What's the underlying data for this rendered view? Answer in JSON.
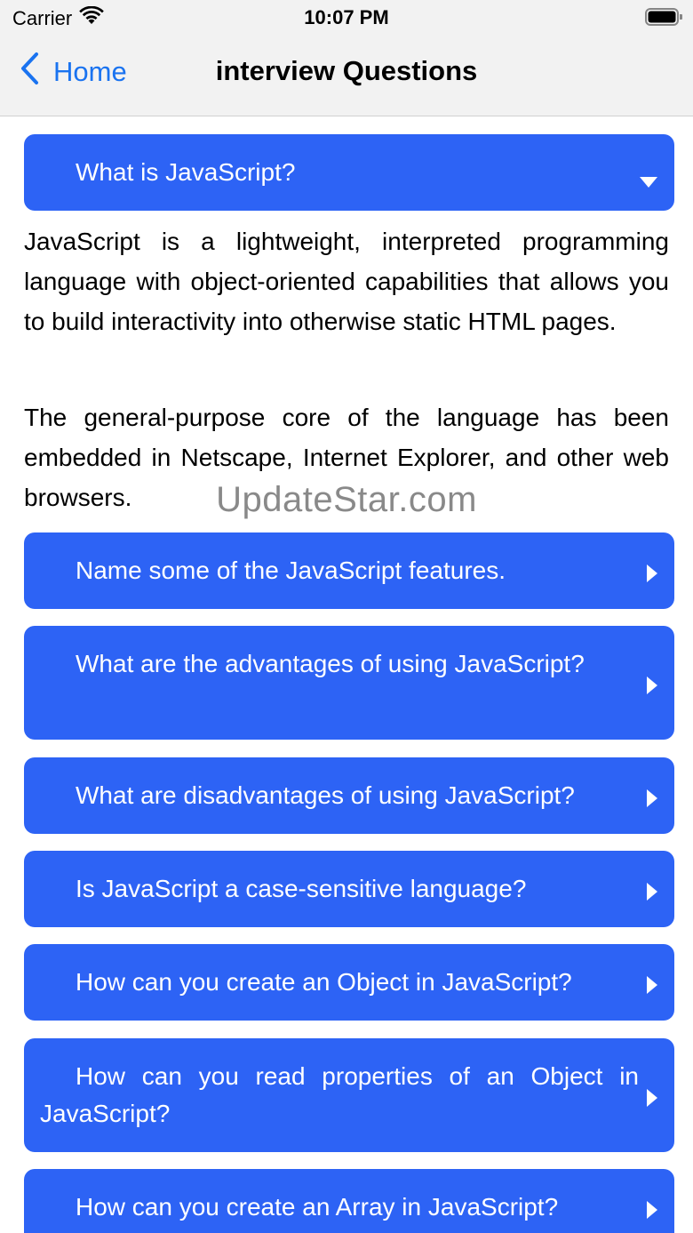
{
  "status_bar": {
    "carrier": "Carrier",
    "time": "10:07 PM"
  },
  "nav": {
    "back_label": "Home",
    "title": "interview Questions"
  },
  "accent_color": "#2d63f5",
  "link_color": "#1a73f0",
  "expanded_question": {
    "label": "What is JavaScript?",
    "icon": "caret-down-icon",
    "answer_paragraphs": [
      "JavaScript is a lightweight, interpreted programming language with object-oriented capabilities that allows you to build interactivity into otherwise static HTML pages.",
      "The general-purpose core of the language has been embedded in Netscape, Internet Explorer, and other web browsers."
    ]
  },
  "questions": [
    {
      "label": "Name some of the JavaScript features.",
      "icon": "caret-right-icon"
    },
    {
      "label": "What are the advantages of using JavaScript?",
      "icon": "caret-right-icon"
    },
    {
      "label": "What are disadvantages of using JavaScript?",
      "icon": "caret-right-icon"
    },
    {
      "label": "Is JavaScript a case-sensitive language?",
      "icon": "caret-right-icon"
    },
    {
      "label": "How can you create an Object in JavaScript?",
      "icon": "caret-right-icon"
    },
    {
      "label": "How can you read properties of an Object in JavaScript?",
      "icon": "caret-right-icon"
    },
    {
      "label": "How can you create an Array in JavaScript?",
      "icon": "caret-right-icon"
    }
  ],
  "watermark": "UpdateStar.com"
}
